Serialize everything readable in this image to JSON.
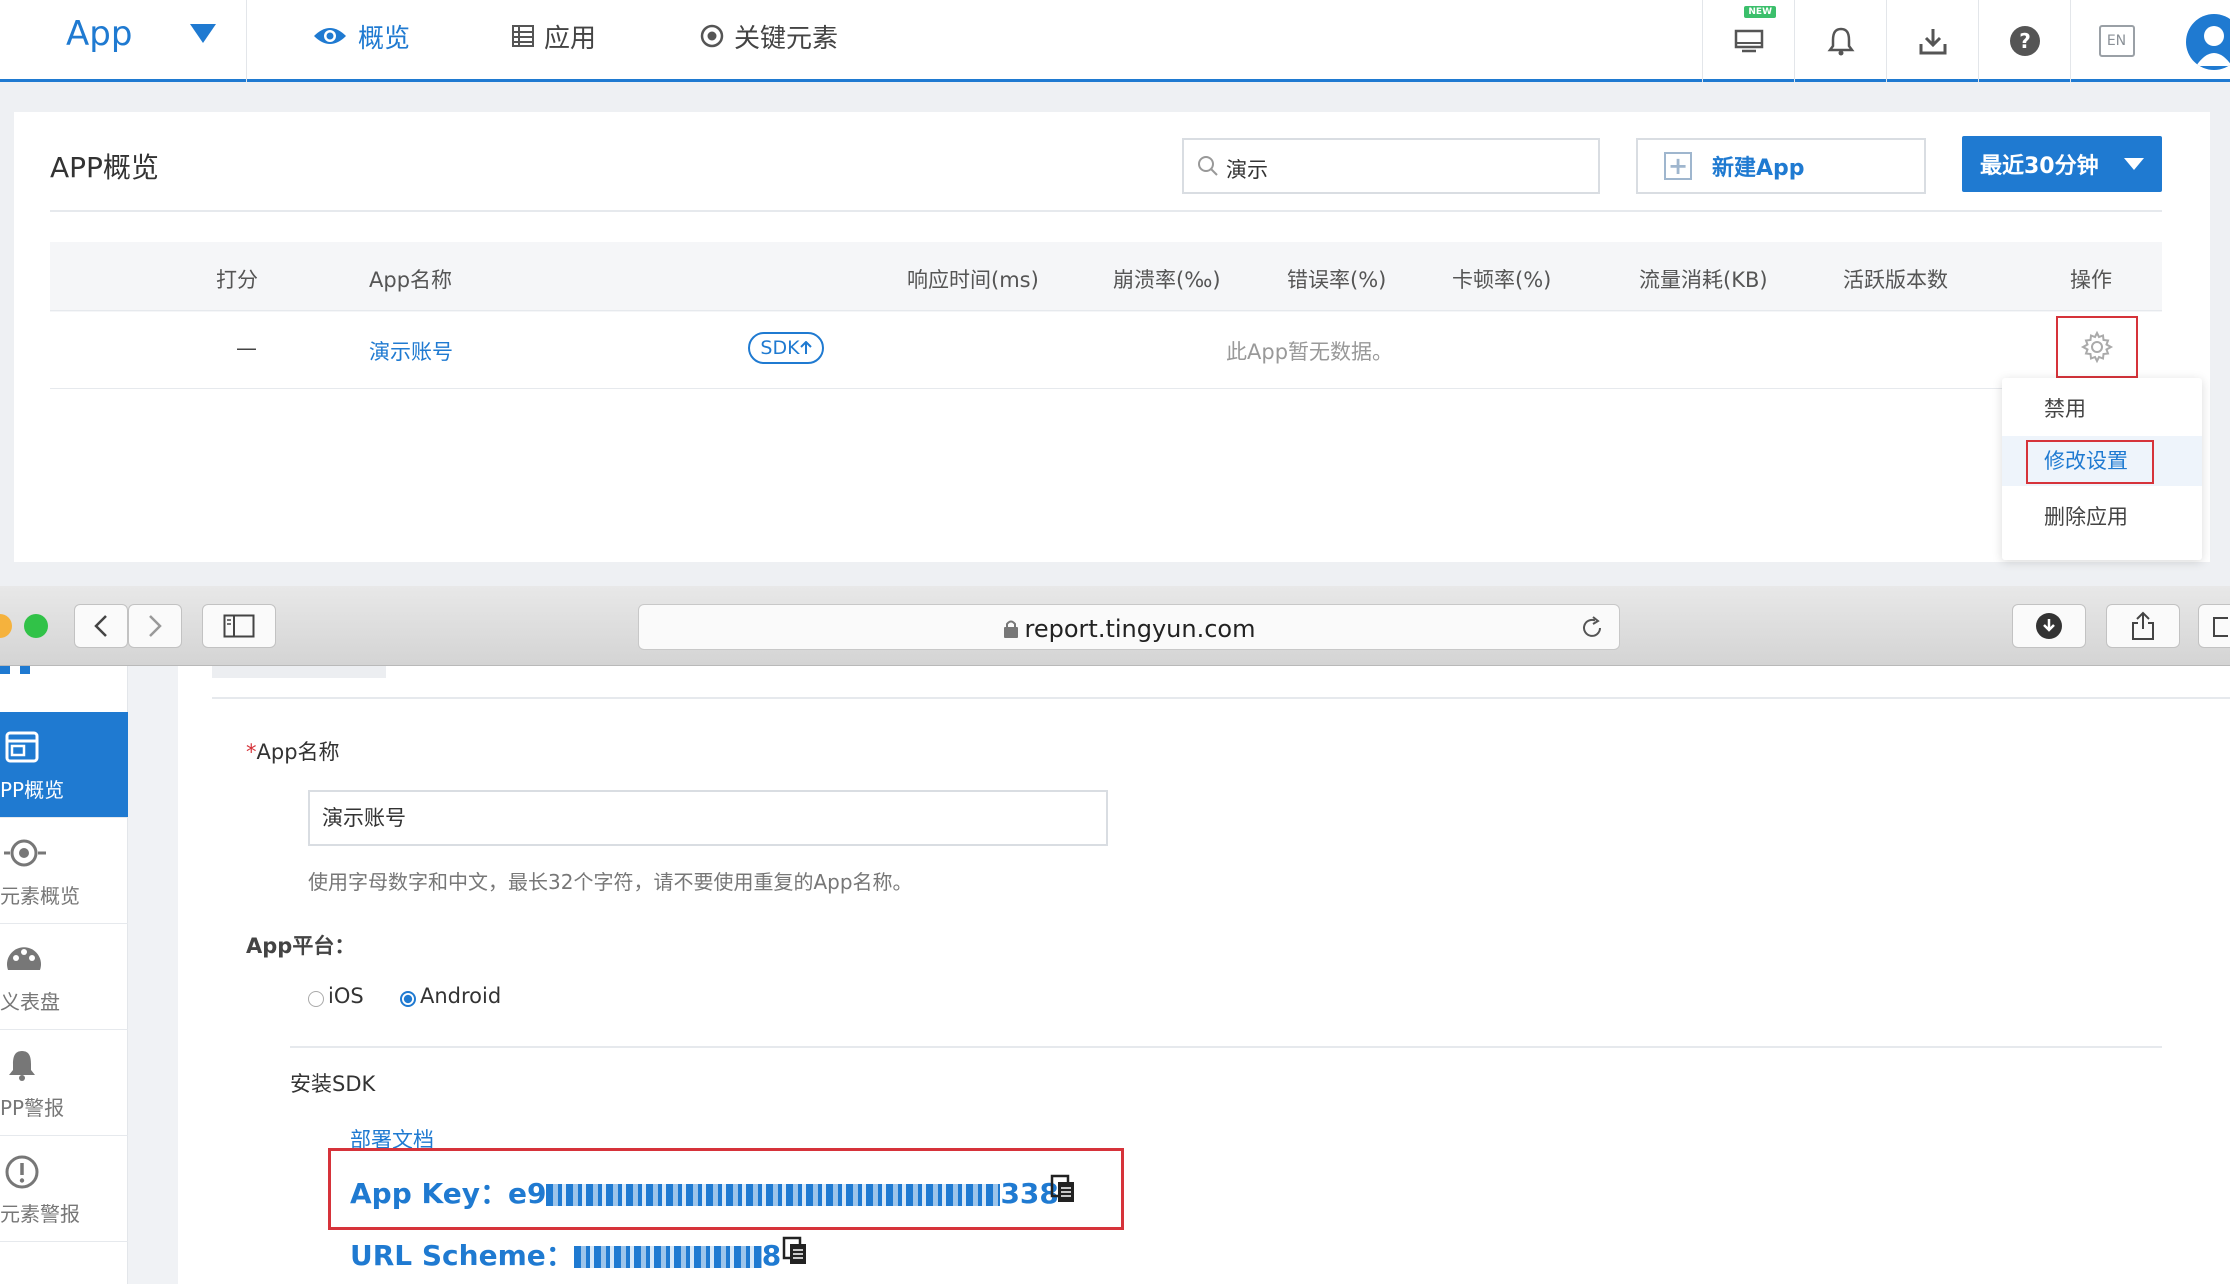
{
  "topbar": {
    "brand": "App",
    "tabs": [
      {
        "label": "概览",
        "icon": "eye-icon",
        "active": true
      },
      {
        "label": "应用",
        "icon": "list-icon",
        "active": false
      },
      {
        "label": "关键元素",
        "icon": "target-icon",
        "active": false
      }
    ],
    "new_badge": "NEW",
    "lang": "EN"
  },
  "overview": {
    "title": "APP概览",
    "search_value": "演示",
    "new_app_label": "新建App",
    "time_range": "最近30分钟",
    "columns": [
      "打分",
      "App名称",
      "响应时间(ms)",
      "崩溃率(‰)",
      "错误率(%)",
      "卡顿率(%)",
      "流量消耗(KB)",
      "活跃版本数",
      "操作"
    ],
    "row": {
      "score": "—",
      "name": "演示账号",
      "sdk": "SDK",
      "empty_msg": "此App暂无数据。"
    },
    "menu": [
      "禁用",
      "修改设置",
      "删除应用"
    ]
  },
  "browser": {
    "url": "report.tingyun.com"
  },
  "sidebar": {
    "items": [
      {
        "label": "PP概览",
        "icon": "window-icon",
        "active": true
      },
      {
        "label": "元素概览",
        "icon": "target-icon",
        "active": false
      },
      {
        "label": "义表盘",
        "icon": "palette-icon",
        "active": false
      },
      {
        "label": "PP警报",
        "icon": "bell-icon",
        "active": false
      },
      {
        "label": "元素警报",
        "icon": "alert-icon",
        "active": false
      }
    ]
  },
  "settings": {
    "name_label": "App名称",
    "name_value": "演示账号",
    "name_hint": "使用字母数字和中文，最长32个字符，请不要使用重复的App名称。",
    "platform_label": "App平台：",
    "platforms": [
      {
        "label": "iOS",
        "selected": false
      },
      {
        "label": "Android",
        "selected": true
      }
    ],
    "sdk_title": "安装SDK",
    "doc_link": "部署文档",
    "app_key_label": "App Key：",
    "app_key_start": "e9",
    "app_key_end": "338",
    "url_scheme_label": "URL Scheme：",
    "url_scheme_end": "8"
  },
  "colors": {
    "accent": "#1f7ad1",
    "highlight": "#d6333a"
  }
}
